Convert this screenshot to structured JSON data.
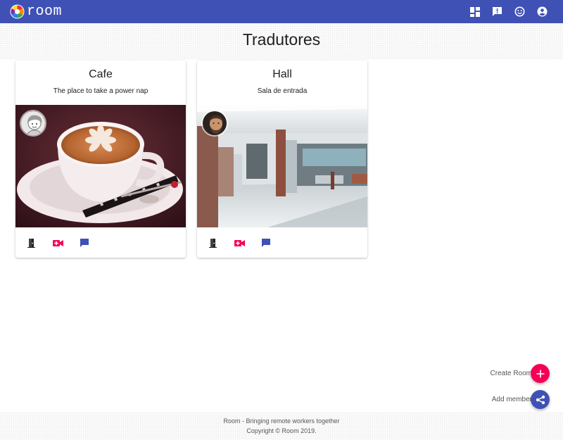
{
  "app": {
    "name": "room",
    "colors": {
      "primary": "#3f51b5",
      "accent": "#f50057"
    },
    "toolbar_icons": [
      "dashboard-icon",
      "feedback-icon",
      "emoji-icon",
      "account-icon"
    ]
  },
  "page": {
    "title": "Tradutores"
  },
  "rooms": [
    {
      "name": "Cafe",
      "description": "The place to take a power nap",
      "image": "coffee-cup-image",
      "avatar": "sketch-avatar",
      "actions": [
        "enter-room-icon",
        "video-call-icon",
        "chat-icon"
      ]
    },
    {
      "name": "Hall",
      "description": "Sala de entrada",
      "image": "hallway-image",
      "avatar": "bearded-man-avatar",
      "actions": [
        "enter-room-icon",
        "video-call-icon",
        "chat-icon"
      ]
    }
  ],
  "fabs": {
    "create_room": {
      "label": "Create Room",
      "icon": "plus-icon"
    },
    "add_member": {
      "label": "Add member",
      "icon": "share-icon"
    }
  },
  "footer": {
    "line1": "Room - Bringing remote workers together",
    "line2": "Copyright © Room 2019."
  }
}
